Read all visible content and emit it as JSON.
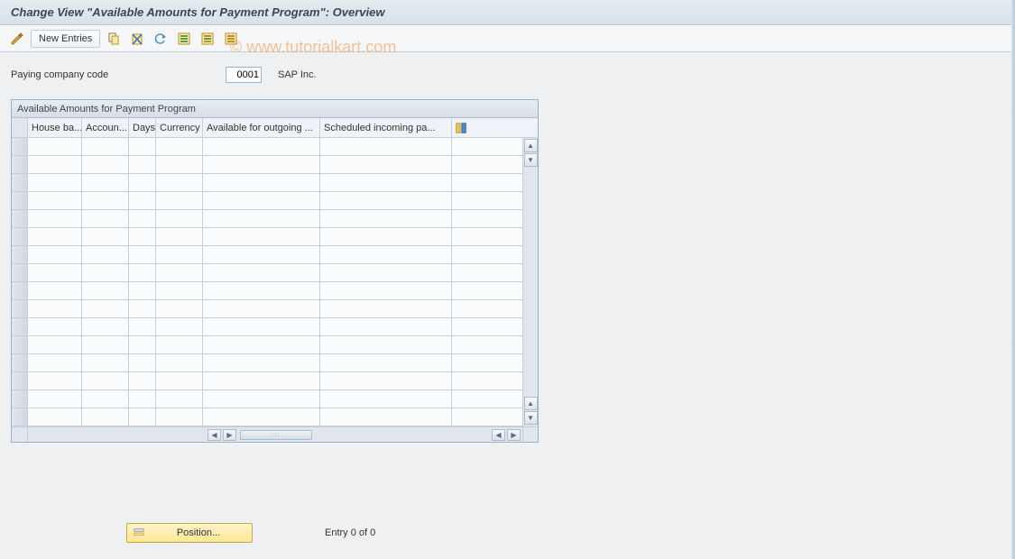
{
  "title": "Change View \"Available Amounts for Payment Program\": Overview",
  "watermark": "© www.tutorialkart.com",
  "toolbar": {
    "new_entries": "New Entries"
  },
  "form": {
    "paying_cc_label": "Paying company code",
    "paying_cc_value": "0001",
    "paying_cc_desc": "SAP Inc."
  },
  "table": {
    "title": "Available Amounts for Payment Program",
    "columns": {
      "house_bank": "House ba...",
      "account": "Accoun...",
      "days": "Days",
      "currency": "Currency",
      "outgoing": "Available for outgoing ...",
      "incoming": "Scheduled incoming pa..."
    },
    "row_count": 16
  },
  "footer": {
    "position_label": "Position...",
    "entry_text": "Entry 0 of 0"
  }
}
